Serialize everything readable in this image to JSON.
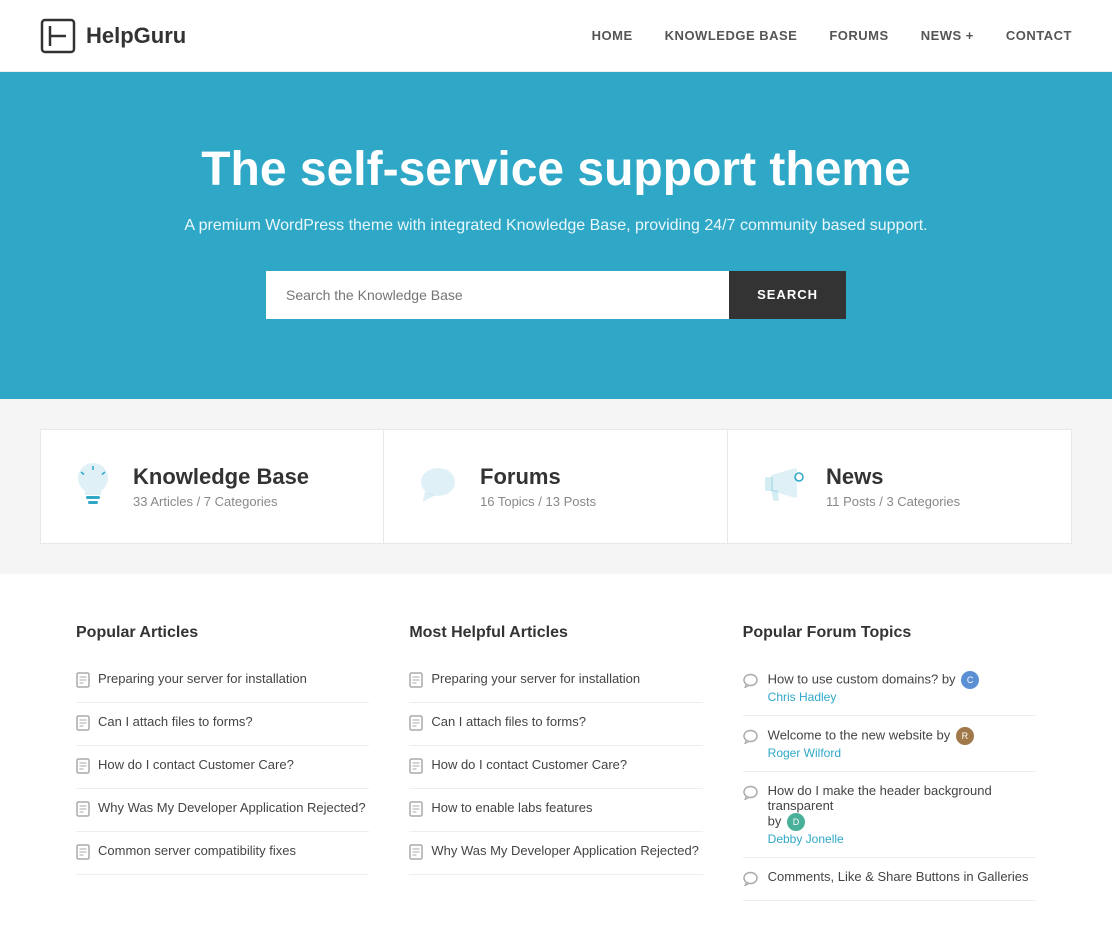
{
  "header": {
    "logo_text": "HelpGuru",
    "nav": [
      {
        "label": "HOME",
        "id": "home"
      },
      {
        "label": "KNOWLEDGE BASE",
        "id": "knowledge-base"
      },
      {
        "label": "FORUMS",
        "id": "forums"
      },
      {
        "label": "NEWS +",
        "id": "news"
      },
      {
        "label": "CONTACT",
        "id": "contact"
      }
    ]
  },
  "hero": {
    "title": "The self-service support theme",
    "subtitle": "A premium WordPress theme with integrated Knowledge Base, providing 24/7 community based support.",
    "search_placeholder": "Search the Knowledge Base",
    "search_button": "SEARCH"
  },
  "stats": [
    {
      "id": "knowledge-base-stat",
      "title": "Knowledge Base",
      "detail": "33 Articles / 7 Categories",
      "icon": "lightbulb"
    },
    {
      "id": "forums-stat",
      "title": "Forums",
      "detail": "16 Topics / 13 Posts",
      "icon": "chat"
    },
    {
      "id": "news-stat",
      "title": "News",
      "detail": "11 Posts / 3 Categories",
      "icon": "megaphone"
    }
  ],
  "popular_articles": {
    "title": "Popular Articles",
    "items": [
      "Preparing your server for installation",
      "Can I attach files to forms?",
      "How do I contact Customer Care?",
      "Why Was My Developer Application Rejected?",
      "Common server compatibility fixes"
    ]
  },
  "helpful_articles": {
    "title": "Most Helpful Articles",
    "items": [
      "Preparing your server for installation",
      "Can I attach files to forms?",
      "How do I contact Customer Care?",
      "How to enable labs features",
      "Why Was My Developer Application Rejected?"
    ]
  },
  "forum_topics": {
    "title": "Popular Forum Topics",
    "items": [
      {
        "title": "How to use custom domains?",
        "by": "by",
        "author": "Chris Hadley",
        "avatar_color": "blue"
      },
      {
        "title": "Welcome to the new website",
        "by": "by",
        "author": "Roger Wilford",
        "avatar_color": "brown"
      },
      {
        "title": "How do I make the header background transparent",
        "by": "by",
        "author": "Debby Jonelle",
        "avatar_color": "teal"
      },
      {
        "title": "Comments, Like & Share Buttons in Galleries",
        "by": "",
        "author": "",
        "avatar_color": ""
      }
    ]
  }
}
